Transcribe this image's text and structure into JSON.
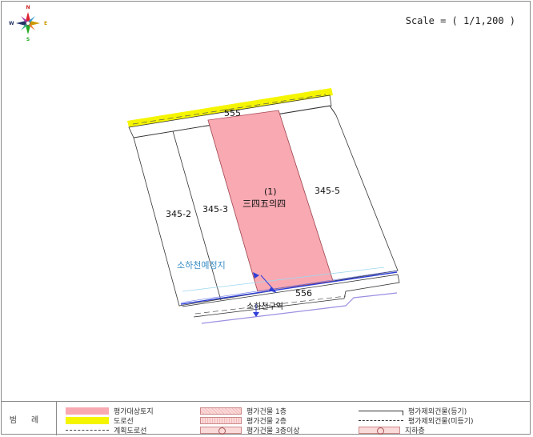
{
  "compass": {
    "north": "N",
    "south": "S",
    "west": "W",
    "east": "E"
  },
  "scale_text": "Scale = ( 1/1,200 )",
  "map": {
    "parcels": [
      {
        "id": "555",
        "label": "555"
      },
      {
        "id": "345-2",
        "label": "345-2"
      },
      {
        "id": "345-3",
        "label": "345-3"
      },
      {
        "id": "subject",
        "label_num": "(1)",
        "label": "三四五의四"
      },
      {
        "id": "345-5",
        "label": "345-5"
      },
      {
        "id": "556",
        "label": "556"
      }
    ],
    "annotations": {
      "stream": "소하천예정지",
      "zone": "소하천구역"
    }
  },
  "legend": {
    "title": "범례",
    "items": [
      {
        "id": "eval-land",
        "label": "평가대상토지"
      },
      {
        "id": "road-line",
        "label": "도로선"
      },
      {
        "id": "planned-road",
        "label": "계획도로선"
      },
      {
        "id": "bldg-1",
        "label": "평가건물 1층"
      },
      {
        "id": "bldg-2",
        "label": "평가건물 2층"
      },
      {
        "id": "bldg-3",
        "label": "평가건물 3층이상"
      },
      {
        "id": "excl-reg",
        "label": "평가제외건물(등기)"
      },
      {
        "id": "excl-unreg",
        "label": "평가제외건물(미등기)"
      },
      {
        "id": "basement",
        "label": "지하층"
      }
    ]
  },
  "colors": {
    "subject_fill": "#f8a9b2",
    "road_yellow": "#f5f500",
    "stream_blue": "#2f3fd8",
    "zone_purple": "#9b8fe0",
    "label_blue": "#3b8fc7"
  }
}
